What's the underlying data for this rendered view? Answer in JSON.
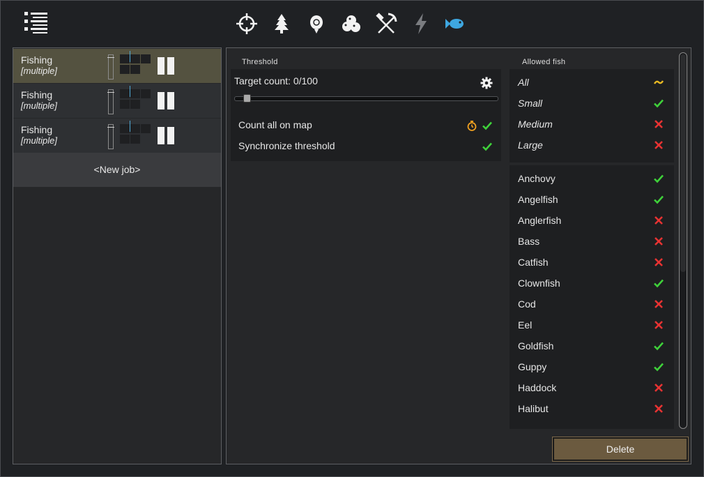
{
  "toolbar": {
    "menu_icon": "list-icon",
    "tabs": [
      {
        "icon": "crosshair-icon",
        "active": false
      },
      {
        "icon": "tree-icon",
        "active": false
      },
      {
        "icon": "seed-icon",
        "active": false
      },
      {
        "icon": "berries-icon",
        "active": false
      },
      {
        "icon": "pickaxe-hammer-icon",
        "active": false
      },
      {
        "icon": "lightning-icon",
        "active": false
      },
      {
        "icon": "fish-icon",
        "active": true
      }
    ]
  },
  "jobs": [
    {
      "title": "Fishing",
      "subtitle": "[multiple]",
      "selected": true
    },
    {
      "title": "Fishing",
      "subtitle": "[multiple]",
      "selected": false
    },
    {
      "title": "Fishing",
      "subtitle": "[multiple]",
      "selected": false
    }
  ],
  "new_job_label": "<New job>",
  "threshold": {
    "section_label": "Threshold",
    "target_label": "Target count: 0/100",
    "target_value": 0,
    "target_max": 100,
    "options": [
      {
        "label": "Count all on map",
        "extra_icon": "stopwatch-icon",
        "checked": true
      },
      {
        "label": "Synchronize threshold",
        "checked": true
      }
    ]
  },
  "allowed_fish": {
    "section_label": "Allowed fish",
    "categories": [
      {
        "label": "All",
        "state": "partial"
      },
      {
        "label": "Small",
        "state": "yes"
      },
      {
        "label": "Medium",
        "state": "no"
      },
      {
        "label": "Large",
        "state": "no"
      }
    ],
    "fish": [
      {
        "label": "Anchovy",
        "state": "yes"
      },
      {
        "label": "Angelfish",
        "state": "yes"
      },
      {
        "label": "Anglerfish",
        "state": "no"
      },
      {
        "label": "Bass",
        "state": "no"
      },
      {
        "label": "Catfish",
        "state": "no"
      },
      {
        "label": "Clownfish",
        "state": "yes"
      },
      {
        "label": "Cod",
        "state": "no"
      },
      {
        "label": "Eel",
        "state": "no"
      },
      {
        "label": "Goldfish",
        "state": "yes"
      },
      {
        "label": "Guppy",
        "state": "yes"
      },
      {
        "label": "Haddock",
        "state": "no"
      },
      {
        "label": "Halibut",
        "state": "no"
      }
    ]
  },
  "delete_label": "Delete",
  "colors": {
    "check": "#3fd13a",
    "cross": "#e83232",
    "partial": "#e8b923",
    "active_tab": "#3ea7e0",
    "selected_row": "#545240",
    "delete_button": "#6b5a3f"
  }
}
